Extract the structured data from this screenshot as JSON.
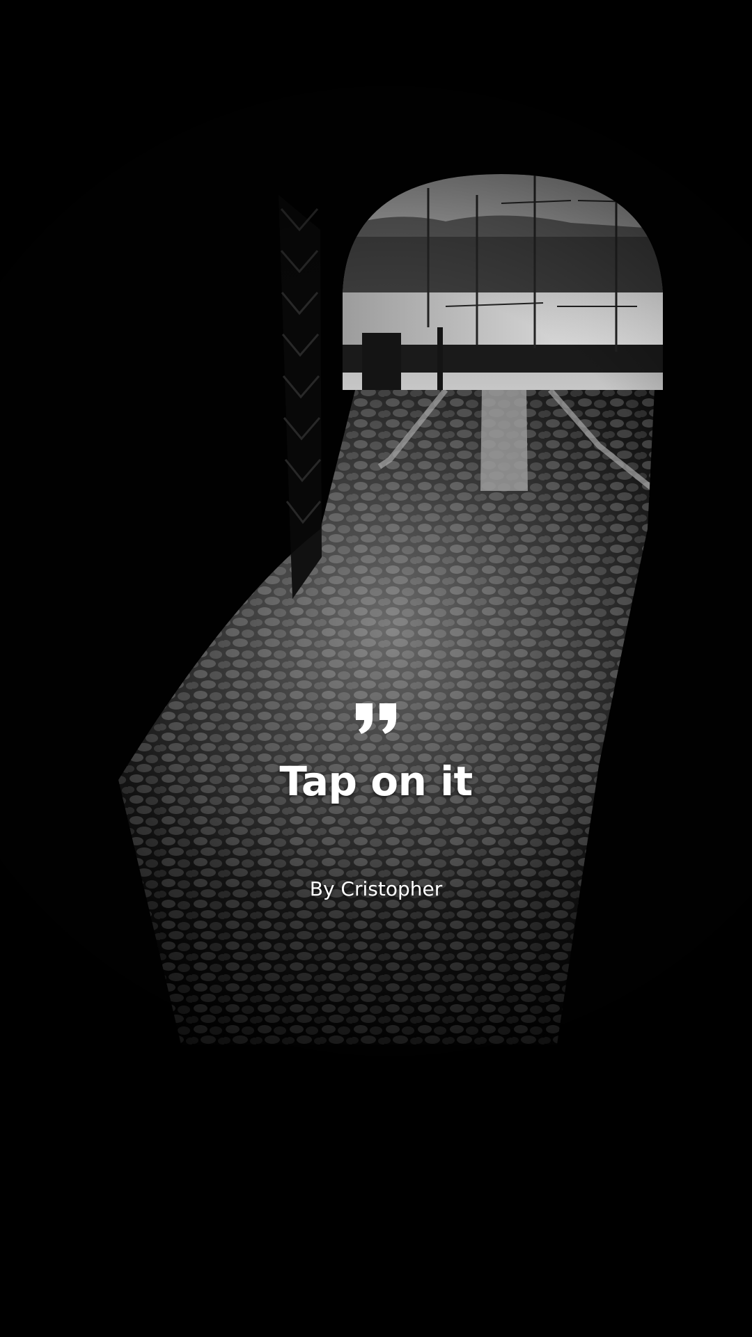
{
  "quote": {
    "icon": "quote-icon",
    "text": "Tap on it",
    "author": "By Cristopher"
  },
  "background": {
    "tone": "black-and-white",
    "base_color": "#020202",
    "sky_color": "#b5b5b5",
    "water_color": "#d9d9d9"
  }
}
